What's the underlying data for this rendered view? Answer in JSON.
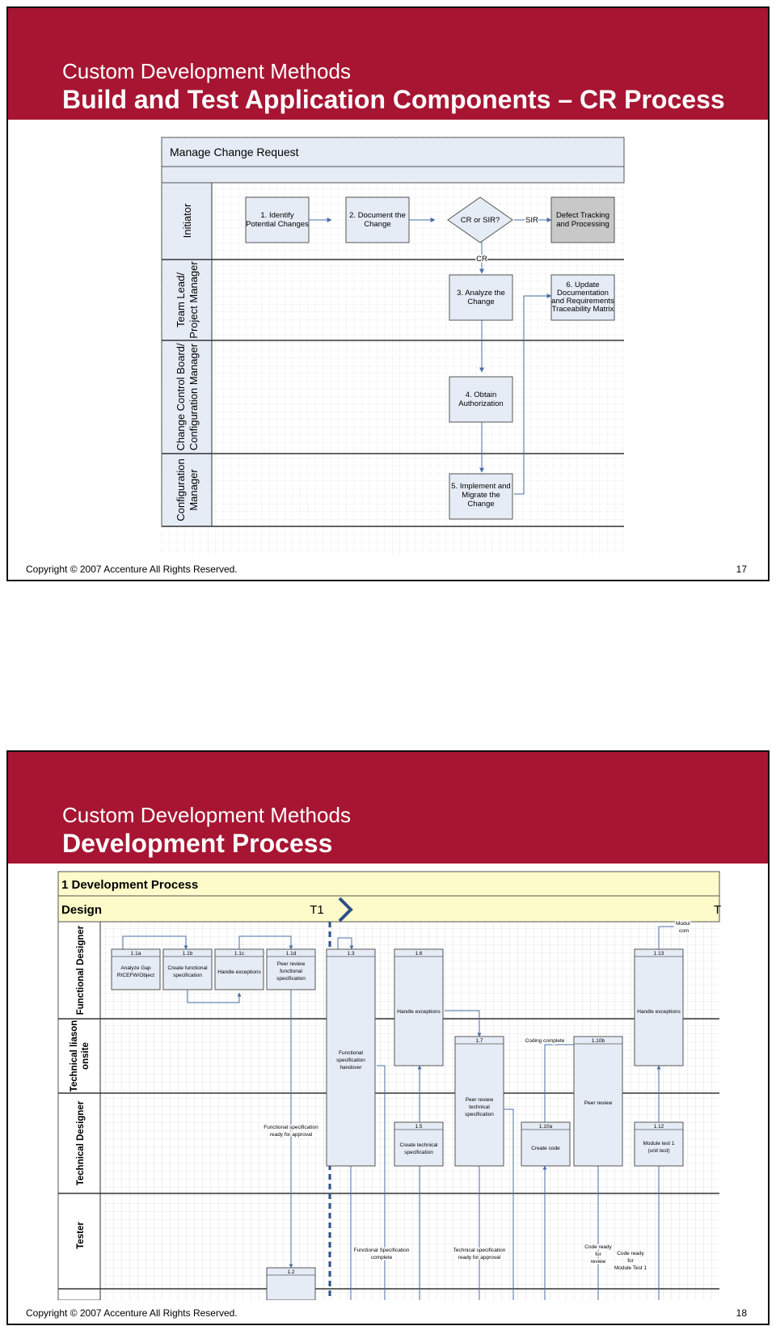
{
  "slide1": {
    "subtitle": "Custom Development Methods",
    "title": "Build and Test Application Components – CR Process",
    "copyright": "Copyright © 2007 Accenture All Rights Reserved.",
    "page": "17",
    "diagram": {
      "title": "Manage Change Request",
      "lanes": {
        "initiator": "Initiator",
        "teamlead_1": "Team Lead/",
        "teamlead_2": "Project Manager",
        "ccb_1": "Change Control Board/",
        "ccb_2": "Configuration Manager",
        "cm_1": "Configuration",
        "cm_2": "Manager"
      },
      "steps": {
        "s1_a": "1. Identify",
        "s1_b": "Potential Changes",
        "s2_a": "2. Document the",
        "s2_b": "Change",
        "decision": "CR or SIR?",
        "sir_label": "SIR",
        "cr_label": "CR",
        "defect_a": "Defect Tracking",
        "defect_b": "and Processing",
        "s3_a": "3. Analyze the",
        "s3_b": "Change",
        "s6_a": "6. Update",
        "s6_b": "Documentation",
        "s6_c": "and Requirements",
        "s6_d": "Traceability Matrix",
        "s4_a": "4. Obtain",
        "s4_b": "Authorization",
        "s5_a": "5. Implement and",
        "s5_b": "Migrate the",
        "s5_c": "Change"
      }
    }
  },
  "slide2": {
    "subtitle": "Custom Development Methods",
    "title": "Development Process",
    "copyright": "Copyright © 2007 Accenture All Rights Reserved.",
    "page": "18",
    "diagram": {
      "title": "1 Development Process",
      "phase": "Design",
      "t1": "T1",
      "t_right": "T",
      "lanes": {
        "functional": "Functional Designer",
        "liaison_1": "Technical liason",
        "liaison_2": "onsite",
        "technical": "Technical Designer",
        "tester": "Tester"
      },
      "boxes": {
        "b11a_id": "1.1a",
        "b11a_1": "Analyze Gap",
        "b11a_2": "RICEFW/Object",
        "b11b_id": "1.1b",
        "b11b_1": "Create functional",
        "b11b_2": "specification",
        "b11c_id": "1.1c",
        "b11c_1": "Handle exceptions",
        "b11d_id": "1.1d",
        "b11d_1": "Peer review",
        "b11d_2": "functional",
        "b11d_3": "specification",
        "b13_id": "1.3",
        "b13_1": "Functional",
        "b13_2": "specification",
        "b13_3": "handover",
        "b16_id": "1.6",
        "b16_1": "Handle exceptions",
        "b17_id": "1.7",
        "b17_1": "Peer review",
        "b17_2": "technical",
        "b17_3": "specification",
        "b15_id": "1.5",
        "b15_1": "Create technical",
        "b15_2": "specification",
        "b110a_id": "1.10a",
        "b110a_1": "Create code",
        "b110b_id": "1.10b",
        "b110b_1": "Peer review",
        "b113_id": "1.13",
        "b113_1": "Handle exceptions",
        "b112_id": "1.12",
        "b112_1": "Module test 1",
        "b112_2": "(unit test)",
        "b12_id": "1.2"
      },
      "notes": {
        "fs_ready_1": "Functional specification",
        "fs_ready_2": "ready for approval",
        "coding_complete": "Coding complete",
        "fs_complete_1": "Functional Specification",
        "fs_complete_2": "complete",
        "ts_ready_1": "Technical specification",
        "ts_ready_2": "ready for approval",
        "code_ready_review_1": "Code ready",
        "code_ready_review_2": "for",
        "code_ready_review_3": "review",
        "code_ready_test_1": "Code ready",
        "code_ready_test_2": "for",
        "code_ready_test_3": "Module Test 1",
        "module_1": "Modul",
        "module_2": "com"
      }
    }
  }
}
